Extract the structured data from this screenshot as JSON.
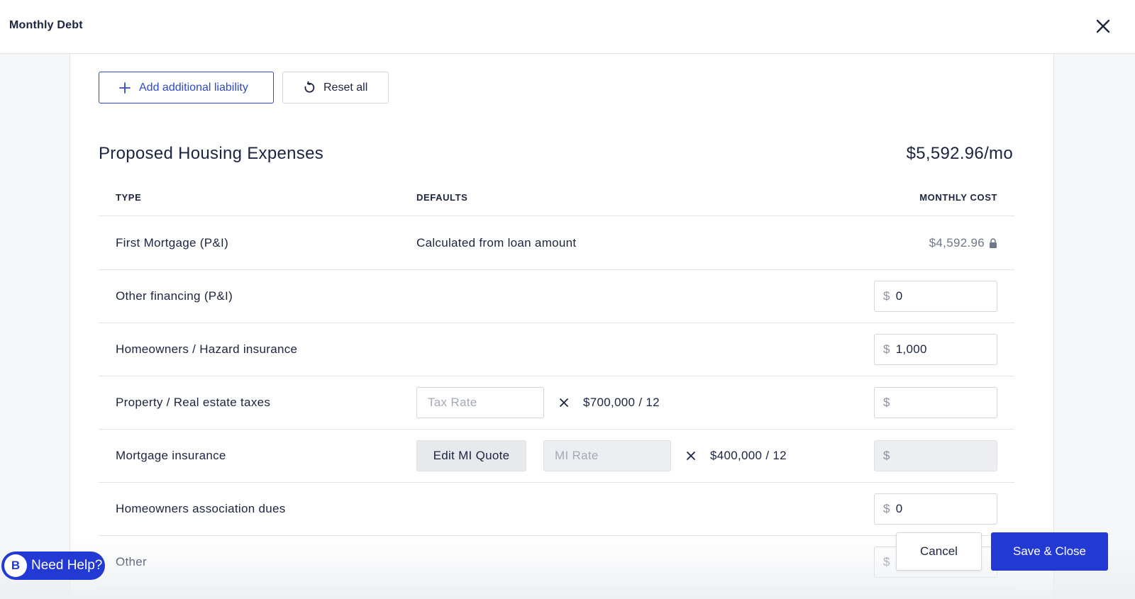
{
  "window": {
    "title": "Monthly Debt"
  },
  "toolbar": {
    "add_label": "Add additional liability",
    "reset_label": "Reset all"
  },
  "section": {
    "title": "Proposed Housing Expenses",
    "total": "$5,592.96/mo"
  },
  "table": {
    "headers": {
      "type": "TYPE",
      "defaults": "DEFAULTS",
      "cost": "MONTHLY COST"
    },
    "rows": [
      {
        "type": "First Mortgage (P&I)",
        "defaults": "Calculated from loan amount",
        "cost": "$4,592.96"
      },
      {
        "type": "Other financing (P&I)",
        "currency": "$",
        "value": "0"
      },
      {
        "type": "Homeowners / Hazard insurance",
        "currency": "$",
        "value": "1,000"
      },
      {
        "type": "Property / Real estate taxes",
        "rate_placeholder": "Tax Rate",
        "multiplier": "$700,000 / 12",
        "currency": "$",
        "value": ""
      },
      {
        "type": "Mortgage insurance",
        "button_label": "Edit MI Quote",
        "rate_placeholder": "MI Rate",
        "multiplier": "$400,000 / 12",
        "currency": "$",
        "value": ""
      },
      {
        "type": "Homeowners association dues",
        "currency": "$",
        "value": "0"
      },
      {
        "type": "Other",
        "currency": "$",
        "value": ""
      }
    ]
  },
  "footer": {
    "cancel_label": "Cancel",
    "save_label": "Save & Close"
  },
  "help": {
    "label": "Need Help?",
    "logo_letter": "B"
  },
  "colors": {
    "primary": "#2339d3",
    "outline_blue": "#2f49c9",
    "text": "#1c2440",
    "muted": "#707789",
    "border": "#d3d6dd"
  }
}
